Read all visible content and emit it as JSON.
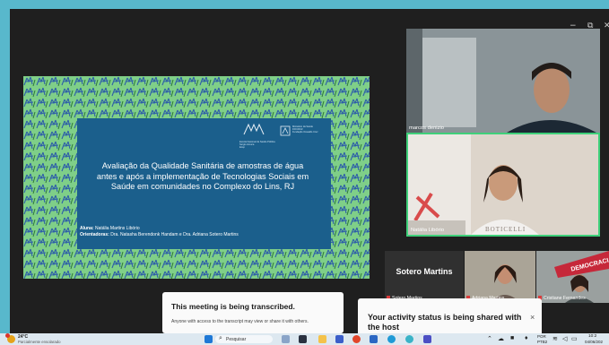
{
  "window": {
    "minimize_icon": "minimize-icon",
    "maximize_icon": "maximize-icon",
    "close_icon": "close-icon"
  },
  "slide": {
    "title": "Avaliação da Qualidade Sanitária de amostras de água antes e após a implementação de Tecnologias Sociais em Saúde em comunidades no Complexo do Lins, RJ",
    "student_label": "Aluna:",
    "student_name": "Natália Martins Libório",
    "advisors_label": "Orientadoras:",
    "advisors_names": "Dra. Natasha Berendonk Handam e Dra. Adriana Sotero Martins",
    "logo1_text": "Escola Nacional de Saúde Pública\nSergio Arouca\nEnsp",
    "logo2_text": "Ministério da Saúde\nFIOCRUZ\nFundação Oswaldo Cruz"
  },
  "participants": [
    {
      "name": "marcos denizio"
    },
    {
      "name": "Natália Libório"
    },
    {
      "name": "Sotero Martins",
      "initials_label": "Sotero Martins"
    },
    {
      "name": "Adriana Martins"
    },
    {
      "name": "Cristiane Fernandes"
    }
  ],
  "banner_text": "DEMOCRACIA",
  "shirt_text": "BOTICELLI",
  "toasts": {
    "transcribed_title": "This meeting is being transcribed.",
    "transcribed_body": "Anyone with access to the transcript may view or share it with others.",
    "activity_title": "Your activity status is being shared with the host"
  },
  "taskbar": {
    "weather_temp": "24°C",
    "weather_desc": "Parcialmente ensolarado",
    "search_placeholder": "Pesquisar",
    "lang": "POR",
    "lang2": "PTB2",
    "time": "10:2",
    "date": "04/06/202"
  },
  "colors": {
    "slide_green": "#7fcf88",
    "slide_box": "#1b5f8c",
    "active_speaker": "#3fd07a",
    "desktop": "#58b8cc"
  }
}
